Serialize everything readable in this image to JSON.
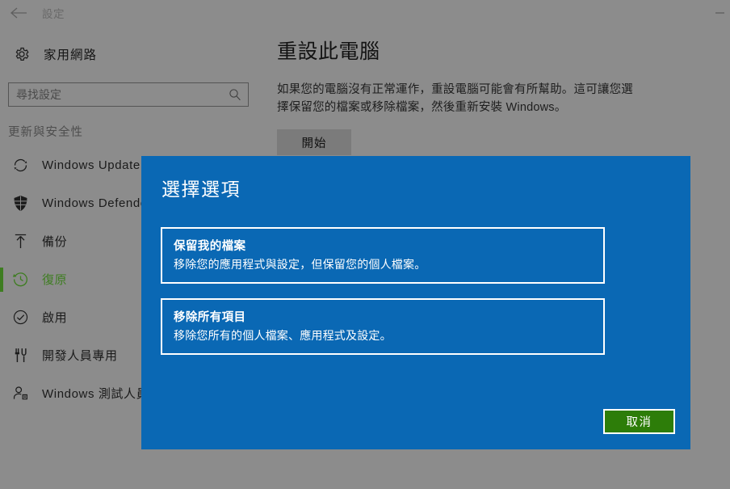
{
  "titlebar": {
    "back_icon": "arrow-left-icon",
    "title": "設定",
    "minimize_label": ""
  },
  "sidebar": {
    "account": {
      "icon": "gear-icon",
      "name": "家用網路"
    },
    "search": {
      "placeholder": "尋找設定",
      "value": "",
      "icon": "search-icon"
    },
    "section_heading": "更新與安全性",
    "items": [
      {
        "icon": "sync-icon",
        "label": "Windows Update",
        "selected": false
      },
      {
        "icon": "shield-icon",
        "label": "Windows Defender",
        "selected": false
      },
      {
        "icon": "upload-arrow-icon",
        "label": "備份",
        "selected": false
      },
      {
        "icon": "history-clock-icon",
        "label": "復原",
        "selected": true
      },
      {
        "icon": "check-circle-icon",
        "label": "啟用",
        "selected": false
      },
      {
        "icon": "tools-icon",
        "label": "開發人員專用",
        "selected": false
      },
      {
        "icon": "person-badge-icon",
        "label": "Windows 測試人員",
        "selected": false
      }
    ],
    "accent_color": "#3e7d21"
  },
  "main": {
    "title": "重設此電腦",
    "description": "如果您的電腦沒有正常運作，重設電腦可能會有所幫助。這可讓您選擇保留您的檔案或移除檔案，然後重新安裝 Windows。",
    "start_button": "開始"
  },
  "dialog": {
    "title": "選擇選項",
    "background_color": "#0a68b4",
    "options": [
      {
        "title": "保留我的檔案",
        "subtitle": "移除您的應用程式與設定，但保留您的個人檔案。"
      },
      {
        "title": "移除所有項目",
        "subtitle": "移除您所有的個人檔案、應用程式及設定。"
      }
    ],
    "cancel_button": "取消",
    "cancel_color": "#2d7d09"
  }
}
